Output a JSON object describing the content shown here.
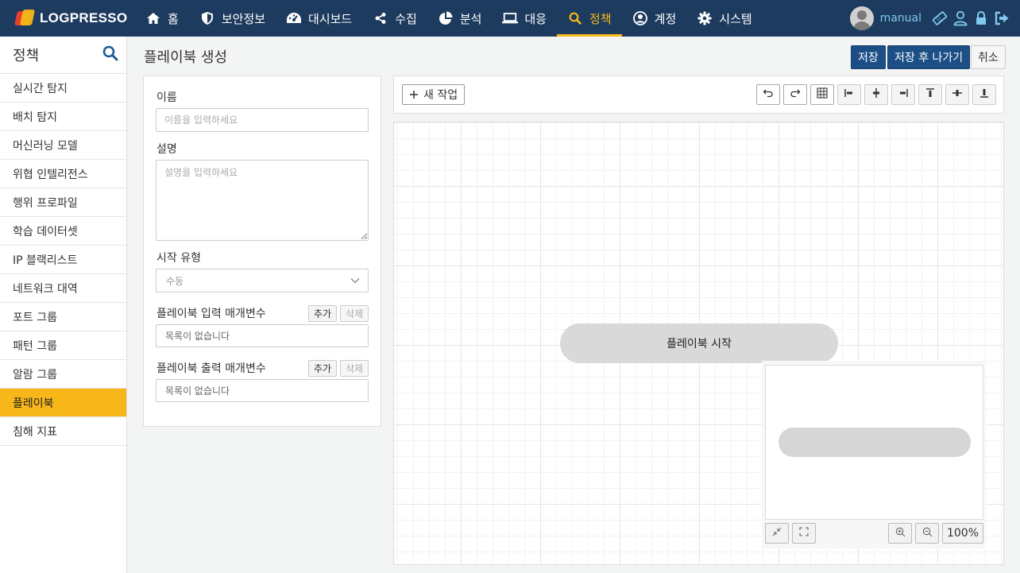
{
  "app": {
    "logo_text": "LOGPRESSO"
  },
  "nav": {
    "items": [
      {
        "label": "홈",
        "icon": "home-icon"
      },
      {
        "label": "보안정보",
        "icon": "shield-icon"
      },
      {
        "label": "대시보드",
        "icon": "dashboard-icon"
      },
      {
        "label": "수집",
        "icon": "share-icon"
      },
      {
        "label": "분석",
        "icon": "pie-chart-icon"
      },
      {
        "label": "대응",
        "icon": "laptop-icon"
      },
      {
        "label": "정책",
        "icon": "search-icon",
        "active": true
      },
      {
        "label": "계정",
        "icon": "user-circle-icon"
      },
      {
        "label": "시스템",
        "icon": "gear-icon"
      }
    ],
    "active_color": "#f7b718",
    "background": "#1d3b5e"
  },
  "user": {
    "name": "manual"
  },
  "sidebar": {
    "title": "정책",
    "items": [
      {
        "label": "실시간 탐지"
      },
      {
        "label": "배치 탐지"
      },
      {
        "label": "머신러닝 모델"
      },
      {
        "label": "위협 인텔리전스"
      },
      {
        "label": "행위 프로파일"
      },
      {
        "label": "학습 데이터셋"
      },
      {
        "label": "IP 블랙리스트"
      },
      {
        "label": "네트워크 대역"
      },
      {
        "label": "포트 그룹"
      },
      {
        "label": "패턴 그룹"
      },
      {
        "label": "알람 그룹"
      },
      {
        "label": "플레이북",
        "active": true
      },
      {
        "label": "침해 지표"
      }
    ]
  },
  "page": {
    "title": "플레이북 생성",
    "save_label": "저장",
    "save_exit_label": "저장 후 나가기",
    "cancel_label": "취소"
  },
  "form": {
    "name_label": "이름",
    "name_placeholder": "이름을 입력하세요",
    "name_value": "",
    "desc_label": "설명",
    "desc_placeholder": "설명을 입력하세요",
    "desc_value": "",
    "start_type_label": "시작 유형",
    "start_type_value": "수동",
    "input_params_label": "플레이북 입력 매개변수",
    "output_params_label": "플레이북 출력 매개변수",
    "add_label": "추가",
    "delete_label": "삭제",
    "empty_list_text": "목록이 없습니다"
  },
  "toolbar": {
    "new_task_label": "새 작업"
  },
  "canvas": {
    "start_node_label": "플레이북 시작",
    "zoom_label": "100%"
  }
}
